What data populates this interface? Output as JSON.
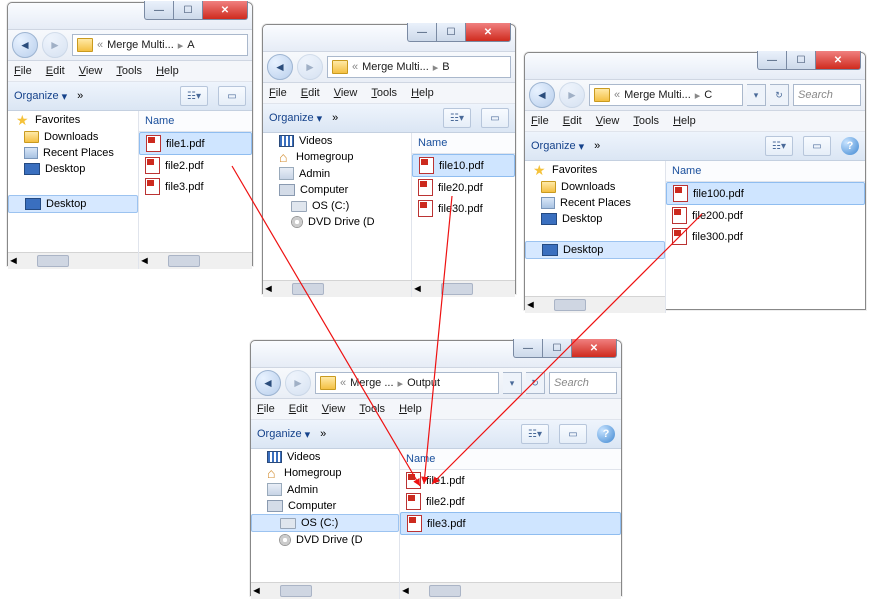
{
  "menus": {
    "file": "File",
    "edit": "Edit",
    "view": "View",
    "tools": "Tools",
    "help": "Help"
  },
  "toolbar": {
    "organize": "Organize",
    "more": "»"
  },
  "column": {
    "name": "Name"
  },
  "search_placeholder": "Search",
  "tree": {
    "favorites": "Favorites",
    "downloads": "Downloads",
    "recent": "Recent Places",
    "desktop": "Desktop",
    "videos": "Videos",
    "homegroup": "Homegroup",
    "admin": "Admin",
    "computer": "Computer",
    "osc": "OS (C:)",
    "dvd": "DVD Drive (D"
  },
  "windows": {
    "A": {
      "crumb1": "Merge Multi...",
      "crumb2": "A",
      "files": [
        "file1.pdf",
        "file2.pdf",
        "file3.pdf"
      ],
      "sel": 0
    },
    "B": {
      "crumb1": "Merge Multi...",
      "crumb2": "B",
      "files": [
        "file10.pdf",
        "file20.pdf",
        "file30.pdf"
      ],
      "sel": 0
    },
    "C": {
      "crumb1": "Merge Multi...",
      "crumb2": "C",
      "files": [
        "file100.pdf",
        "file200.pdf",
        "file300.pdf"
      ],
      "sel": 0
    },
    "Out": {
      "crumb1": "Merge ...",
      "crumb2": "Output",
      "files": [
        "file1.pdf",
        "file2.pdf",
        "file3.pdf"
      ],
      "sel": 2
    }
  },
  "chart_data": {
    "type": "diagram",
    "description": "Three Windows Explorer folders A, B, C each containing PDF files merge into an Output folder",
    "sources": [
      {
        "folder": "A",
        "files": [
          "file1.pdf",
          "file2.pdf",
          "file3.pdf"
        ]
      },
      {
        "folder": "B",
        "files": [
          "file10.pdf",
          "file20.pdf",
          "file30.pdf"
        ]
      },
      {
        "folder": "C",
        "files": [
          "file100.pdf",
          "file200.pdf",
          "file300.pdf"
        ]
      }
    ],
    "output": {
      "folder": "Output",
      "files": [
        "file1.pdf",
        "file2.pdf",
        "file3.pdf"
      ]
    },
    "arrows": [
      {
        "from": "A.file1.pdf",
        "to": "Output.file1.pdf"
      },
      {
        "from": "B.file10.pdf",
        "to": "Output.file1.pdf"
      },
      {
        "from": "C.file100.pdf",
        "to": "Output.file1.pdf"
      }
    ]
  }
}
